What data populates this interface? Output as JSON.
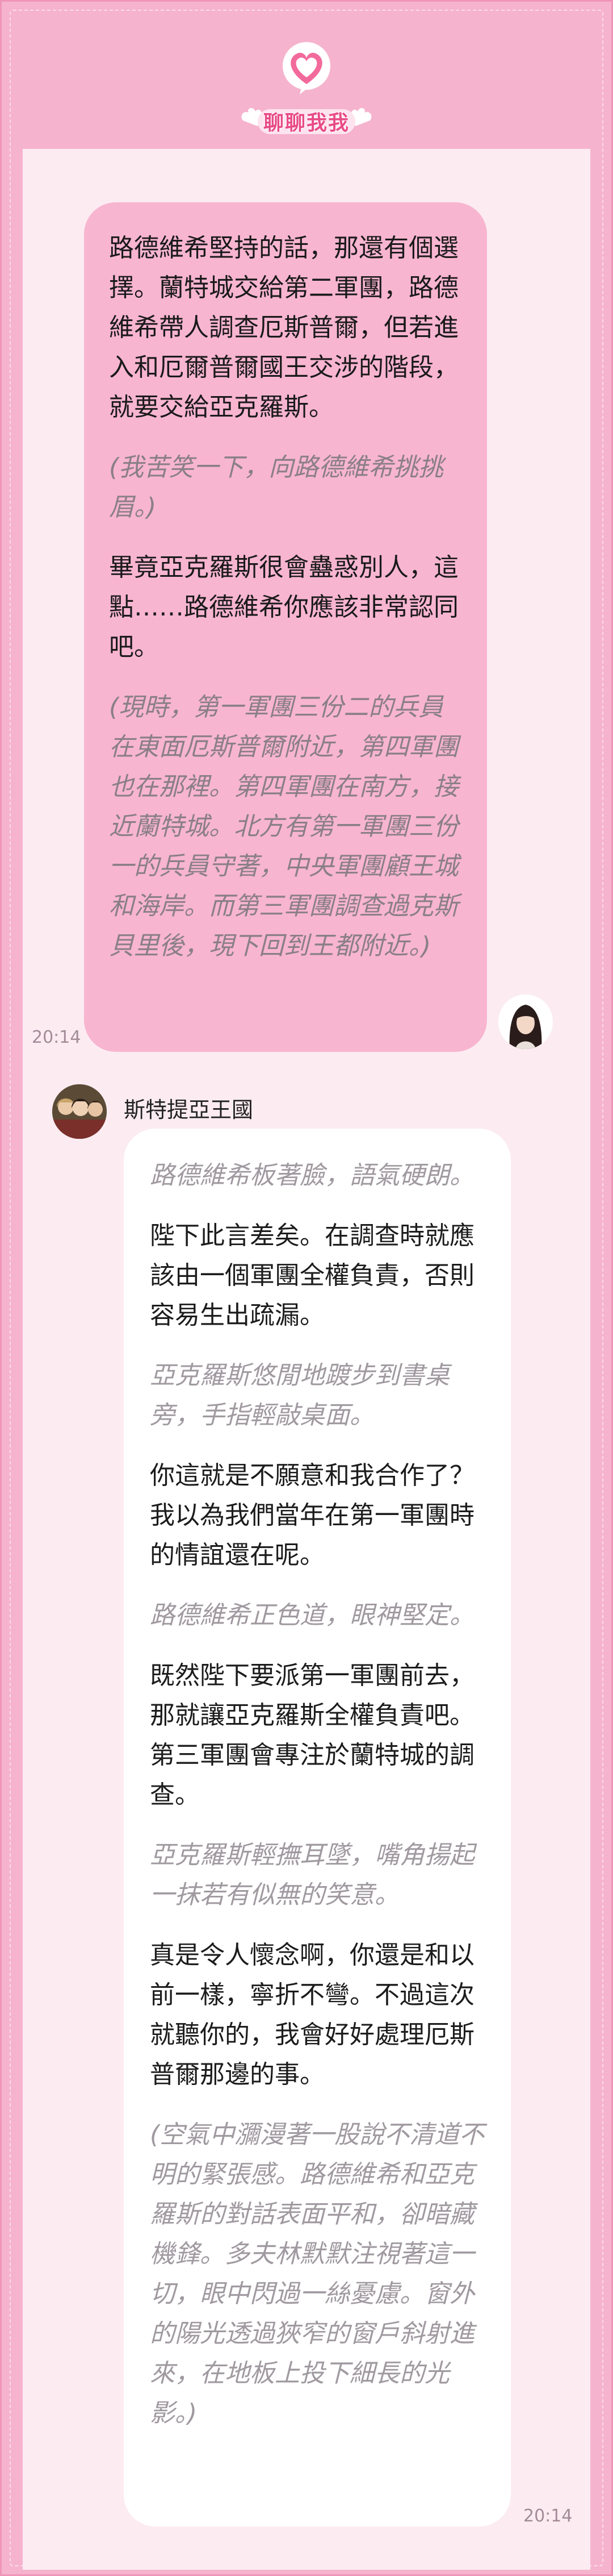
{
  "app": {
    "logo_text": "聊聊我我"
  },
  "messages": {
    "outgoing": {
      "time": "20:14",
      "paragraphs": [
        {
          "text": "路德維希堅持的話，那還有個選擇。蘭特城交給第二軍團，路德維希帶人調查厄斯普爾，但若進入和厄爾普爾國王交涉的階段，就要交給亞克羅斯。",
          "narration": false
        },
        {
          "text": "(我苦笑一下，向路德維希挑挑眉。)",
          "narration": true
        },
        {
          "text": "畢竟亞克羅斯很會蠱惑別人，這點……路德維希你應該非常認同吧。",
          "narration": false
        },
        {
          "text": "(現時，第一軍團三份二的兵員在東面厄斯普爾附近，第四軍團也在那裡。第四軍團在南方，接近蘭特城。北方有第一軍團三份一的兵員守著，中央軍團顧王城和海岸。而第三軍團調查過克斯貝里後，現下回到王都附近。)",
          "narration": true
        }
      ]
    },
    "incoming": {
      "sender": "斯特提亞王國",
      "time": "20:14",
      "paragraphs": [
        {
          "text": "路德維希板著臉，語氣硬朗。",
          "narration": true
        },
        {
          "text": "陛下此言差矣。在調查時就應該由一個軍團全權負責，否則容易生出疏漏。",
          "narration": false
        },
        {
          "text": "亞克羅斯悠閒地踱步到書桌旁，手指輕敲桌面。",
          "narration": true
        },
        {
          "text": "你這就是不願意和我合作了？我以為我們當年在第一軍團時的情誼還在呢。",
          "narration": false
        },
        {
          "text": "路德維希正色道，眼神堅定。",
          "narration": true
        },
        {
          "text": "既然陛下要派第一軍團前去，那就讓亞克羅斯全權負責吧。第三軍團會專注於蘭特城的調查。",
          "narration": false
        },
        {
          "text": "亞克羅斯輕撫耳墜，嘴角揚起一抹若有似無的笑意。",
          "narration": true
        },
        {
          "text": "真是令人懷念啊，你還是和以前一樣，寧折不彎。不過這次就聽你的，我會好好處理厄斯普爾那邊的事。",
          "narration": false
        },
        {
          "text": "(空氣中瀰漫著一股說不清道不明的緊張感。路德維希和亞克羅斯的對話表面平和，卻暗藏機鋒。多夫林默默注視著這一切，眼中閃過一絲憂慮。窗外的陽光透過狹窄的窗戶斜射進來，在地板上投下細長的光影。)",
          "narration": true
        }
      ]
    }
  },
  "colors": {
    "background": "#f6b3cd",
    "panel": "#fcecf2",
    "outgoing_bubble": "#f8b5d0",
    "incoming_bubble": "#ffffff",
    "accent": "#e84b86"
  }
}
